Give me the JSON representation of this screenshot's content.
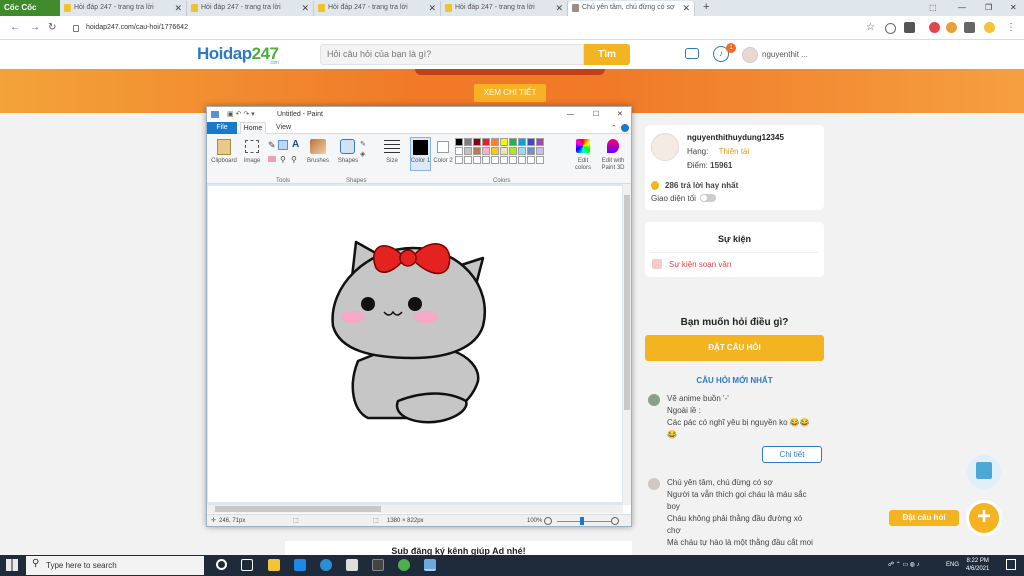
{
  "browser": {
    "brand": "Cốc Cốc",
    "tabs": [
      {
        "title": "Hỏi đáp 247 - trang tra lời"
      },
      {
        "title": "Hỏi đáp 247 - trang tra lời"
      },
      {
        "title": "Hỏi đáp 247 - trang tra lời"
      },
      {
        "title": "Hỏi đáp 247 - trang tra lời"
      },
      {
        "title": "Chú yên tâm, chú đừng có sợ"
      }
    ],
    "url": "hoidap247.com/cau-hoi/1776642",
    "new_tab": "+"
  },
  "site": {
    "logo_main": "Hoidap",
    "logo_num": "247",
    "logo_sub": ".com",
    "search_placeholder": "Hỏi câu hỏi của bạn là gì?",
    "search_button": "Tìm",
    "notification_count": "1",
    "username_short": "nguyenthit ...",
    "banner_button": "XEM CHI TIẾT"
  },
  "profile": {
    "name": "nguyenthithuydung12345",
    "rank_label": "Hạng:",
    "rank_value": "Thiên tài",
    "points_label": "Điểm:",
    "points_value": "15961",
    "best_answers": "286 trả lời hay nhất",
    "dark_mode_label": "Giao diện tối"
  },
  "events": {
    "title": "Sự kiện",
    "item": "Sự kiện soạn văn"
  },
  "ask": {
    "prompt": "Bạn muốn hỏi điều gì?",
    "button": "ĐẶT CÂU HỎI"
  },
  "latest": {
    "title": "CÂU HỎI MỚI NHẤT",
    "q1_lines": [
      "Vẽ anime buồn '-'",
      "Ngoài lề :",
      "Các pác có nghĩ yêu bị nguyền ko 😂😂",
      "😂"
    ],
    "detail_button": "Chi tiết",
    "q2_lines": [
      "Chú yên tâm, chú đừng có sợ",
      "Người ta vẫn thích gọi cháu là máu sắc",
      "boy",
      "Cháu không phải thằng đầu đường xó",
      "chợ",
      "Mà cháu tự hào là một thằng đầu cắt moi"
    ]
  },
  "floating": {
    "ask_label": "Đặt câu hỏi",
    "plus": "+"
  },
  "subscribe_text": "Sub đăng ký kênh giúp Ad nhé!",
  "paint": {
    "title": "Untitled - Paint",
    "menu_file": "File",
    "menu_home": "Home",
    "menu_view": "View",
    "tools": {
      "clipboard": "Clipboard",
      "image": "Image",
      "tools": "Tools",
      "brushes": "Brushes",
      "shapes": "Shapes",
      "size": "Size",
      "color1": "Color 1",
      "color2": "Color 2",
      "edit_colors": "Edit colors",
      "edit_paint3d": "Edit with Paint 3D"
    },
    "groups": {
      "tools": "Tools",
      "shapes": "Shapes",
      "colors": "Colors"
    },
    "palette_row1": [
      "#000000",
      "#7f7f7f",
      "#880015",
      "#ed1c24",
      "#ff7f27",
      "#fff200",
      "#22b14c",
      "#00a2e8",
      "#3f48cc",
      "#a349a4"
    ],
    "palette_row2": [
      "#ffffff",
      "#c3c3c3",
      "#b97a57",
      "#ffaec9",
      "#ffc90e",
      "#efe4b0",
      "#b5e61d",
      "#99d9ea",
      "#7092be",
      "#c8bfe7"
    ],
    "status_pos": "246, 71px",
    "status_size": "1380 × 822px",
    "zoom": "100%"
  },
  "taskbar": {
    "search": "Type here to search",
    "lang": "ENG",
    "time": "8:22 PM",
    "date": "4/6/2021"
  }
}
